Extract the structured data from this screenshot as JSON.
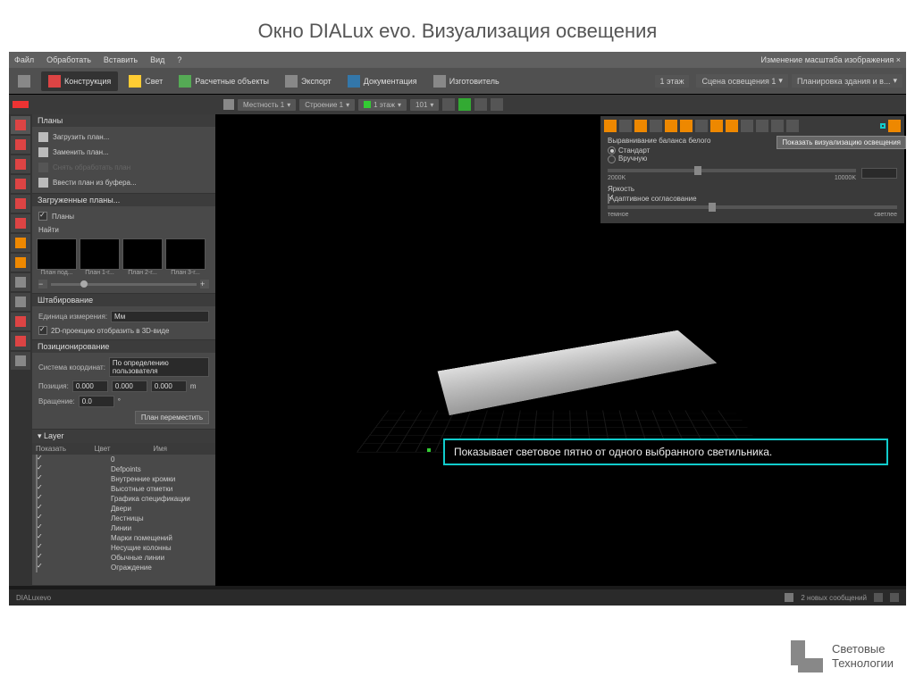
{
  "slide_title": "Окно DIALux evo. Визуализация освещения",
  "menubar": {
    "items": [
      "Файл",
      "Обработать",
      "Вставить",
      "Вид",
      "?"
    ],
    "right": "Изменение масштаба изображения ×"
  },
  "ribbon": {
    "tabs": [
      "Конструкция",
      "Свет",
      "Расчетные объекты",
      "Экспорт",
      "Документация",
      "Изготовитель"
    ],
    "right_dropdowns": [
      "1 этаж",
      "Сцена освещения 1",
      "Планировка здания и в..."
    ]
  },
  "context_bar": {
    "items": [
      "Местность 1",
      "Строение 1",
      "1 этаж",
      "101"
    ]
  },
  "plans_panel": {
    "title": "Планы",
    "load": "Загрузить план...",
    "replace": "Заменить план...",
    "disabled": "Снять обработать план",
    "buffer": "Ввести план из буфера...",
    "loaded": "Загруженные планы...",
    "planы": "Планы",
    "search": "Найти",
    "thumbs": [
      "План под...",
      "План 1-г...",
      "План 2-г...",
      "План 3-г..."
    ]
  },
  "scaling": {
    "title": "Штабирование",
    "unit_label": "Единица измерения:",
    "unit": "Мм",
    "checkbox": "2D-проекцию отобразить в 3D-виде"
  },
  "positioning": {
    "title": "Позиционирование",
    "coord_label": "Система координат:",
    "coord_value": "По определению пользователя",
    "pos_label": "Позиция:",
    "v1": "0.000",
    "v2": "0.000",
    "v3": "0.000",
    "unit": "m",
    "rotation_label": "Вращение:",
    "rotation": "0.0",
    "button": "План переместить"
  },
  "layers": {
    "title": "Layer",
    "col_show": "Показать",
    "col_color": "Цвет",
    "col_name": "Имя",
    "rows": [
      {
        "name": "0",
        "green": false
      },
      {
        "name": "Defpoints",
        "green": false
      },
      {
        "name": "Внутренние кромки",
        "green": false
      },
      {
        "name": "Высотные отметки",
        "green": false
      },
      {
        "name": "Графика спецификации",
        "green": false
      },
      {
        "name": "Двери",
        "green": false
      },
      {
        "name": "Лестницы",
        "green": false
      },
      {
        "name": "Линии",
        "green": true
      },
      {
        "name": "Марки помещений",
        "green": false
      },
      {
        "name": "Несущие колонны",
        "green": false
      },
      {
        "name": "Обычные линии",
        "green": false
      },
      {
        "name": "Ограждение",
        "green": false
      }
    ]
  },
  "vis_panel": {
    "tooltip": "Показать визуализацию освещения",
    "wb_title": "Выравнивание баланса белого",
    "opt_standard": "Стандарт",
    "opt_manual": "Вручную",
    "min_k": "2000K",
    "max_k": "10000K",
    "brightness": "Яркость",
    "adaptive": "Адаптивное согласование",
    "dark": "темное",
    "light": "светлее"
  },
  "callout": "Показывает световое пятно от одного выбранного светильника.",
  "statusbar": {
    "left": "DIALuxevo",
    "right": "2 новых сообщений"
  },
  "footer": {
    "line1": "Световые",
    "line2": "Технологии"
  }
}
